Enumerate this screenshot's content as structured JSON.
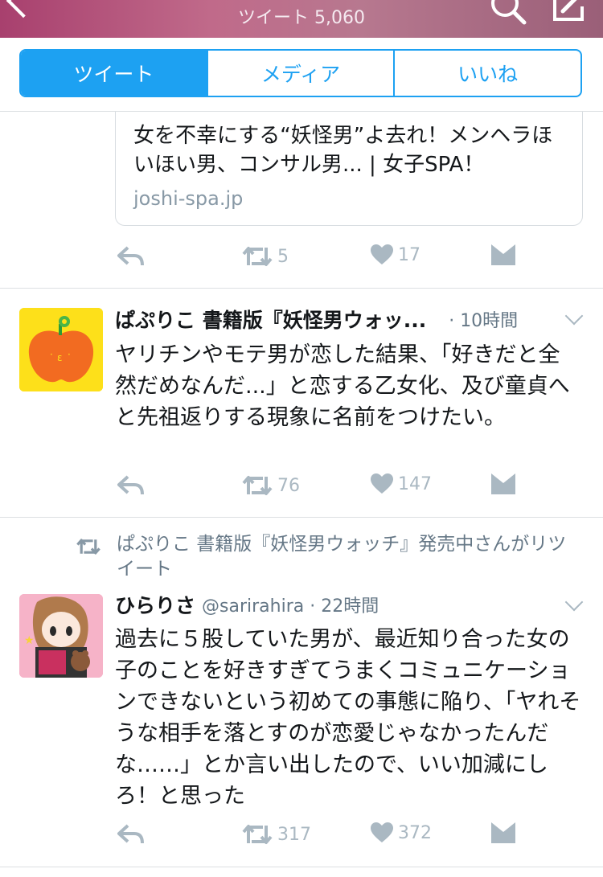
{
  "header": {
    "title": "",
    "subtitle": "ツイート 5,060"
  },
  "tabs": [
    {
      "label": "ツイート",
      "active": true
    },
    {
      "label": "メディア",
      "active": false
    },
    {
      "label": "いいね",
      "active": false
    }
  ],
  "link_card": {
    "title": "女を不幸にする“妖怪男”よ去れ！メンヘラほいほい男、コンサル男... | 女子SPA！",
    "domain": "joshi-spa.jp"
  },
  "card_tweet_actions": {
    "retweets": "5",
    "likes": "17"
  },
  "tweet1": {
    "name": "ぱぷりこ 書籍版『妖怪男ウォッ...",
    "time": "· 10時間",
    "text": "ヤリチンやモテ男が恋した結果、「好きだと全然だめなんだ...」と恋する乙女化、及び童貞へと先祖返りする現象に名前をつけたい。",
    "retweets": "76",
    "likes": "147"
  },
  "tweet2": {
    "retweet_context": "ぱぷりこ 書籍版『妖怪男ウォッチ』発売中さんがリツイート",
    "name": "ひらりさ",
    "handle": "@sarirahira · 22時間",
    "text": "過去に５股していた男が、最近知り合った女の子のことを好きすぎてうまくコミュニケーションできないという初めての事態に陥り、「ヤれそうな相手を落とすのが恋愛じゃなかったんだな……」とか言い出したので、いい加減にしろ！と思った",
    "retweets": "317",
    "likes": "372"
  },
  "colors": {
    "accent": "#1da1f2",
    "icon_gray": "#aab8c2",
    "header": "#b5607f"
  },
  "icons": [
    "back-icon",
    "search-icon",
    "compose-icon",
    "reply-icon",
    "retweet-icon",
    "like-icon",
    "dm-icon",
    "chevron-down-icon"
  ]
}
